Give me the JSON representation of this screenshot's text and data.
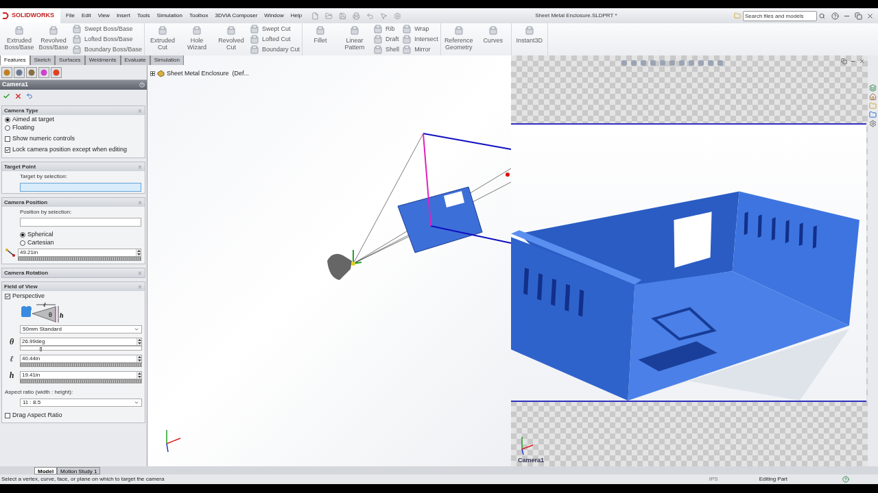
{
  "app": {
    "logo": "SOLIDWORKS"
  },
  "menu": [
    "File",
    "Edit",
    "View",
    "Insert",
    "Tools",
    "Simulation",
    "Toolbox",
    "3DVIA Composer",
    "Window",
    "Help"
  ],
  "document_title": "Sheet Metal Enclosure.SLDPRT *",
  "search": {
    "placeholder": "Search files and models"
  },
  "command_groups": [
    [
      {
        "kind": "large",
        "label": "Extruded Boss/Base"
      },
      {
        "kind": "large",
        "label": "Revolved Boss/Base"
      },
      {
        "kind": "stack",
        "items": [
          "Swept Boss/Base",
          "Lofted Boss/Base",
          "Boundary Boss/Base"
        ]
      }
    ],
    [
      {
        "kind": "large",
        "label": "Extruded Cut"
      },
      {
        "kind": "large",
        "label": "Hole Wizard"
      },
      {
        "kind": "large",
        "label": "Revolved Cut"
      },
      {
        "kind": "stack",
        "items": [
          "Swept Cut",
          "Lofted Cut",
          "Boundary Cut"
        ]
      }
    ],
    [
      {
        "kind": "large",
        "label": "Fillet"
      },
      {
        "kind": "large",
        "label": "Linear Pattern"
      },
      {
        "kind": "stack",
        "items": [
          "Rib",
          "Draft",
          "Shell"
        ]
      },
      {
        "kind": "stack",
        "items": [
          "Wrap",
          "Intersect",
          "Mirror"
        ]
      }
    ],
    [
      {
        "kind": "large",
        "label": "Reference Geometry"
      },
      {
        "kind": "large",
        "label": "Curves"
      }
    ],
    [
      {
        "kind": "large",
        "label": "Instant3D"
      }
    ]
  ],
  "tabs": [
    {
      "label": "Features",
      "selected": true
    },
    {
      "label": "Sketch",
      "selected": false
    },
    {
      "label": "Surfaces",
      "selected": false
    },
    {
      "label": "Weldments",
      "selected": false
    },
    {
      "label": "Evaluate",
      "selected": false
    },
    {
      "label": "Simulation",
      "selected": false
    }
  ],
  "property_manager": {
    "title": "Camera1",
    "sections": [
      {
        "kind": "camera_type",
        "title": "Camera Type",
        "expanded": true,
        "options": [
          {
            "label": "Aimed at target",
            "selected": true
          },
          {
            "label": "Floating",
            "selected": false
          }
        ],
        "checkboxes": [
          {
            "label": "Show numeric controls",
            "checked": false
          },
          {
            "label": "Lock camera position except when editing",
            "checked": true
          }
        ]
      },
      {
        "kind": "target",
        "title": "Target Point",
        "expanded": true,
        "field_label": "Target by selection:",
        "active": true
      },
      {
        "kind": "position",
        "title": "Camera Position",
        "expanded": true,
        "field_label": "Position by selection:",
        "active": false,
        "options": [
          {
            "label": "Spherical",
            "selected": true
          },
          {
            "label": "Cartesian",
            "selected": false
          }
        ],
        "distance": "49.21in"
      },
      {
        "kind": "rotation",
        "title": "Camera Rotation",
        "expanded": false
      },
      {
        "kind": "fov",
        "title": "Field of View",
        "expanded": true,
        "perspective": {
          "label": "Perspective",
          "checked": true
        },
        "diagram_labels": [
          "ℓ",
          "θ",
          "h"
        ],
        "lens": "50mm Standard",
        "angle": {
          "symbol": "θ",
          "value": "26.99deg",
          "level": 0.16
        },
        "length": {
          "symbol": "ℓ",
          "value": "40.44in"
        },
        "height": {
          "symbol": "h",
          "value": "19.41in"
        },
        "aspect_label": "Aspect ratio (width : height):",
        "aspect": "11 : 8.5",
        "drag": {
          "label": "Drag Aspect Ratio",
          "checked": false
        }
      }
    ]
  },
  "tree": {
    "root": "Sheet Metal Enclosure  (Def..."
  },
  "camera_view": {
    "label": "Camera1"
  },
  "bottom_tabs": [
    {
      "label": "Model",
      "selected": true
    },
    {
      "label": "Motion Study 1",
      "selected": false
    }
  ],
  "status_bar": {
    "message": "Select a vertex, curve, face, or plane on which to target the camera",
    "units": "IPS",
    "mode": "Editing Part"
  }
}
